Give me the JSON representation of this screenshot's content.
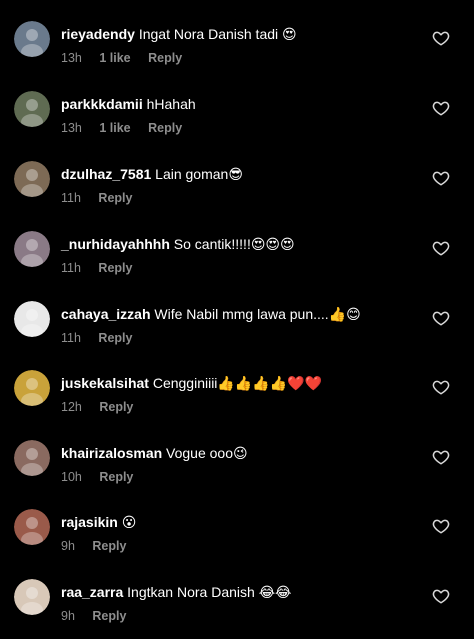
{
  "colors": {
    "background": "#000000",
    "text": "#ffffff",
    "meta": "#8e8e8e"
  },
  "comments": [
    {
      "username": "rieyadendy",
      "text": "Ingat Nora Danish tadi 😍",
      "time": "13h",
      "likes": "1 like",
      "reply": "Reply",
      "avatar_color": "#6a7a8c"
    },
    {
      "username": "parkkkdamii",
      "text": "hHahah",
      "time": "13h",
      "likes": "1 like",
      "reply": "Reply",
      "avatar_color": "#5f6b52"
    },
    {
      "username": "dzulhaz_7581",
      "text": "Lain goman😎",
      "time": "11h",
      "likes": "",
      "reply": "Reply",
      "avatar_color": "#7d6a55"
    },
    {
      "username": "_nurhidayahhhh",
      "text": "So cantik!!!!!😍😍😍",
      "time": "11h",
      "likes": "",
      "reply": "Reply",
      "avatar_color": "#8a7a86"
    },
    {
      "username": "cahaya_izzah",
      "text": "Wife Nabil mmg lawa pun....👍😊",
      "time": "11h",
      "likes": "",
      "reply": "Reply",
      "avatar_color": "#e8e8e8"
    },
    {
      "username": "juskekalsihat",
      "text": "Cengginiiii👍👍👍👍❤️❤️",
      "time": "12h",
      "likes": "",
      "reply": "Reply",
      "avatar_color": "#c9a23a"
    },
    {
      "username": "khairizalosman",
      "text": "Vogue ooo😉",
      "time": "10h",
      "likes": "",
      "reply": "Reply",
      "avatar_color": "#8a6a60"
    },
    {
      "username": "rajasikin",
      "text": "😮",
      "time": "9h",
      "likes": "",
      "reply": "Reply",
      "avatar_color": "#9a5a4a"
    },
    {
      "username": "raa_zarra",
      "text": "Ingtkan Nora Danish 😂😂",
      "time": "9h",
      "likes": "",
      "reply": "Reply",
      "avatar_color": "#d8c8b8"
    }
  ],
  "icons": {
    "like": "heart-outline-icon"
  }
}
